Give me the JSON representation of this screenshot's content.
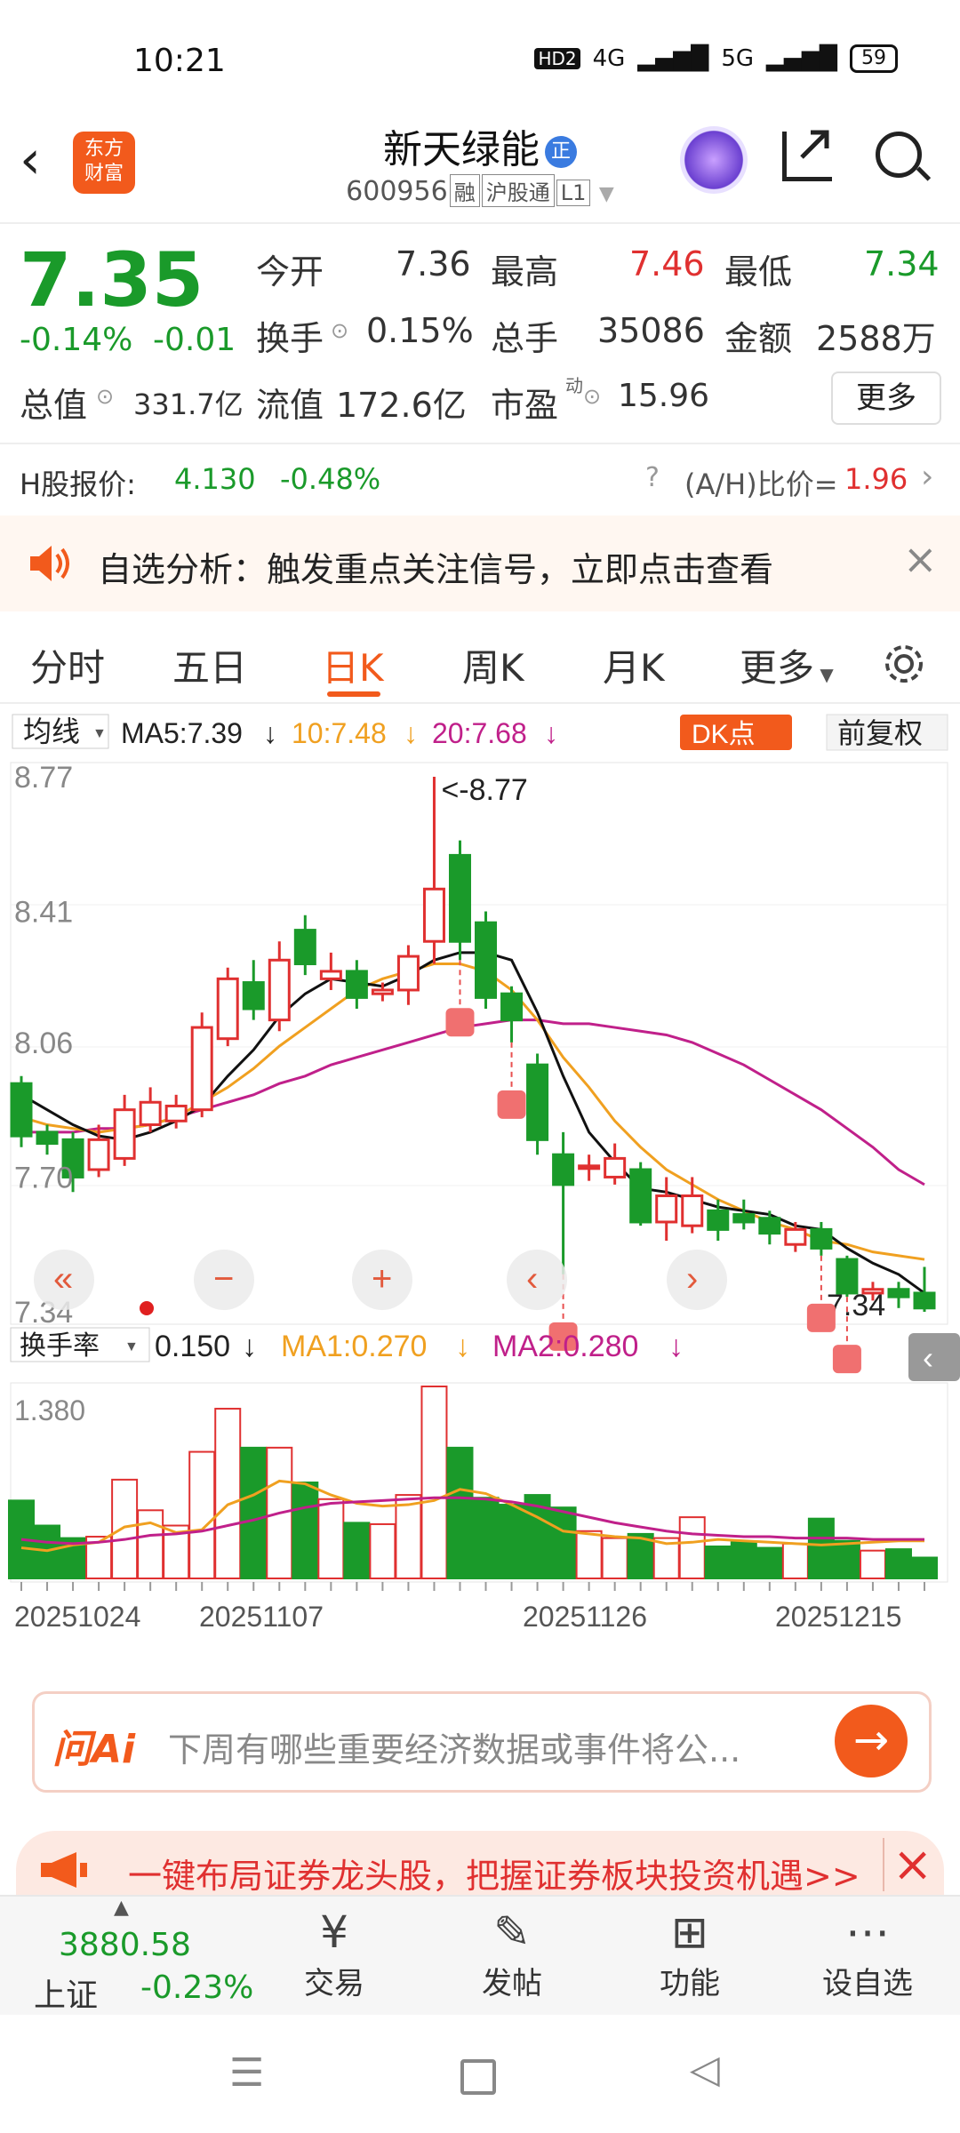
{
  "status": {
    "time": "10:21",
    "hd": "HD2",
    "net1": "4G",
    "net2": "5G",
    "battery": "59"
  },
  "header": {
    "logo_line1": "东方",
    "logo_line2": "财富",
    "stock_name": "新天绿能",
    "stock_badge": "正",
    "stock_code": "600956",
    "tags": [
      "融",
      "沪股通",
      "L1"
    ]
  },
  "quote": {
    "price": "7.35",
    "change_pct": "-0.14%",
    "change": "-0.01",
    "open_label": "今开",
    "open": "7.36",
    "high_label": "最高",
    "high": "7.46",
    "low_label": "最低",
    "low": "7.34",
    "turnover_label": "换手",
    "turnover": "0.15%",
    "volume_label": "总手",
    "volume": "35086",
    "amount_label": "金额",
    "amount": "2588万",
    "mcap_label": "总值",
    "mcap": "331.7亿",
    "float_label": "流值",
    "float": "172.6亿",
    "pe_label": "市盈",
    "pe_sup": "动",
    "pe": "15.96",
    "more": "更多"
  },
  "hshare": {
    "label": "H股报价:",
    "price": "4.130",
    "pct": "-0.48%",
    "ah_label": "(A/H)比价=",
    "ah_value": "1.96"
  },
  "notice": {
    "text": "自选分析：触发重点关注信号，立即点击查看"
  },
  "tabs": [
    "分时",
    "五日",
    "日K",
    "周K",
    "月K",
    "更多"
  ],
  "active_tab": "日K",
  "ma_bar": {
    "select": "均线",
    "ma5": "MA5:7.39",
    "ma10": "10:7.48",
    "ma20": "20:7.68",
    "dk": "DK点",
    "fq": "前复权"
  },
  "vol_bar": {
    "select": "换手率",
    "value": "0.150",
    "ma1": "MA1:0.270",
    "ma2": "MA2:0.280"
  },
  "colors": {
    "up": "#e03030",
    "down": "#1a9a2a",
    "ma5": "#111111",
    "ma10": "#f0a020",
    "ma20": "#c0208a",
    "accent": "#f25a1c"
  },
  "chart_data": {
    "type": "candlestick",
    "y_ticks": [
      "8.77",
      "8.41",
      "8.06",
      "7.70",
      "7.34"
    ],
    "ylim": [
      7.34,
      8.77
    ],
    "max_label": "<-8.77",
    "last_label": "7.34",
    "x_ticks": [
      "20251024",
      "20251107",
      "20251126",
      "20251215"
    ],
    "candles": [
      [
        7.95,
        7.81,
        7.97,
        7.78
      ],
      [
        7.82,
        7.79,
        7.84,
        7.76
      ],
      [
        7.8,
        7.7,
        7.82,
        7.66
      ],
      [
        7.72,
        7.8,
        7.84,
        7.7
      ],
      [
        7.75,
        7.88,
        7.92,
        7.73
      ],
      [
        7.84,
        7.9,
        7.94,
        7.82
      ],
      [
        7.85,
        7.89,
        7.92,
        7.83
      ],
      [
        7.88,
        8.1,
        8.14,
        7.86
      ],
      [
        8.07,
        8.23,
        8.26,
        8.05
      ],
      [
        8.22,
        8.15,
        8.28,
        8.12
      ],
      [
        8.12,
        8.28,
        8.33,
        8.09
      ],
      [
        8.36,
        8.27,
        8.4,
        8.24
      ],
      [
        8.23,
        8.25,
        8.3,
        8.2
      ],
      [
        8.25,
        8.18,
        8.28,
        8.15
      ],
      [
        8.19,
        8.2,
        8.22,
        8.17
      ],
      [
        8.2,
        8.29,
        8.32,
        8.16
      ],
      [
        8.33,
        8.47,
        8.77,
        8.27
      ],
      [
        8.56,
        8.33,
        8.6,
        8.28
      ],
      [
        8.38,
        8.18,
        8.41,
        8.15
      ],
      [
        8.19,
        8.12,
        8.21,
        8.06
      ],
      [
        8.0,
        7.8,
        8.03,
        7.76
      ],
      [
        7.76,
        7.68,
        7.82,
        7.44
      ],
      [
        7.73,
        7.73,
        7.76,
        7.69
      ],
      [
        7.7,
        7.75,
        7.79,
        7.68
      ],
      [
        7.72,
        7.58,
        7.74,
        7.57
      ],
      [
        7.58,
        7.65,
        7.7,
        7.53
      ],
      [
        7.57,
        7.65,
        7.7,
        7.55
      ],
      [
        7.61,
        7.56,
        7.64,
        7.53
      ],
      [
        7.6,
        7.58,
        7.64,
        7.56
      ],
      [
        7.59,
        7.55,
        7.61,
        7.52
      ],
      [
        7.52,
        7.56,
        7.58,
        7.5
      ],
      [
        7.56,
        7.51,
        7.58,
        7.49
      ],
      [
        7.48,
        7.39,
        7.49,
        7.38
      ],
      [
        7.39,
        7.4,
        7.42,
        7.37
      ],
      [
        7.4,
        7.38,
        7.42,
        7.35
      ],
      [
        7.39,
        7.35,
        7.46,
        7.34
      ]
    ],
    "ma5": [
      7.92,
      7.88,
      7.84,
      7.81,
      7.8,
      7.82,
      7.85,
      7.89,
      7.97,
      8.04,
      8.13,
      8.19,
      8.23,
      8.22,
      8.21,
      8.24,
      8.28,
      8.3,
      8.3,
      8.28,
      8.14,
      7.97,
      7.82,
      7.74,
      7.67,
      7.66,
      7.64,
      7.62,
      7.61,
      7.6,
      7.57,
      7.56,
      7.51,
      7.47,
      7.44,
      7.39
    ],
    "ma10": [
      7.86,
      7.84,
      7.83,
      7.82,
      7.83,
      7.84,
      7.86,
      7.9,
      7.94,
      7.99,
      8.05,
      8.1,
      8.15,
      8.2,
      8.23,
      8.25,
      8.27,
      8.27,
      8.25,
      8.2,
      8.12,
      8.02,
      7.94,
      7.85,
      7.78,
      7.72,
      7.68,
      7.64,
      7.61,
      7.58,
      7.56,
      7.53,
      7.52,
      7.5,
      7.49,
      7.48
    ],
    "ma20": [
      7.82,
      7.82,
      7.82,
      7.83,
      7.83,
      7.84,
      7.86,
      7.88,
      7.9,
      7.92,
      7.95,
      7.97,
      8.0,
      8.02,
      8.04,
      8.06,
      8.08,
      8.1,
      8.11,
      8.12,
      8.12,
      8.11,
      8.11,
      8.1,
      8.09,
      8.08,
      8.06,
      8.03,
      8.0,
      7.96,
      7.92,
      7.88,
      7.83,
      7.78,
      7.72,
      7.68
    ],
    "b_markers": [
      17,
      19,
      21,
      31,
      32
    ],
    "volume": {
      "label_max": "1.380",
      "values": [
        0.56,
        0.38,
        0.29,
        0.3,
        0.71,
        0.49,
        0.38,
        0.91,
        1.22,
        0.94,
        0.94,
        0.69,
        0.57,
        0.4,
        0.39,
        0.6,
        1.38,
        0.94,
        0.58,
        0.53,
        0.6,
        0.51,
        0.34,
        0.29,
        0.32,
        0.29,
        0.44,
        0.23,
        0.26,
        0.22,
        0.25,
        0.43,
        0.27,
        0.2,
        0.21,
        0.15
      ],
      "ma1": [
        0.22,
        0.2,
        0.24,
        0.26,
        0.37,
        0.4,
        0.33,
        0.35,
        0.53,
        0.6,
        0.7,
        0.68,
        0.6,
        0.54,
        0.52,
        0.53,
        0.56,
        0.64,
        0.61,
        0.53,
        0.44,
        0.34,
        0.32,
        0.3,
        0.29,
        0.25,
        0.26,
        0.28,
        0.27,
        0.26,
        0.25,
        0.24,
        0.25,
        0.26,
        0.27,
        0.27
      ],
      "ma2": [
        0.28,
        0.26,
        0.25,
        0.26,
        0.28,
        0.31,
        0.32,
        0.34,
        0.38,
        0.42,
        0.47,
        0.51,
        0.54,
        0.55,
        0.56,
        0.57,
        0.58,
        0.58,
        0.57,
        0.55,
        0.52,
        0.48,
        0.44,
        0.4,
        0.37,
        0.34,
        0.32,
        0.31,
        0.3,
        0.3,
        0.29,
        0.29,
        0.29,
        0.28,
        0.28,
        0.28
      ]
    }
  },
  "ai": {
    "logo": "问Ai",
    "placeholder": "下周有哪些重要经济数据或事件将公..."
  },
  "promo": {
    "text": "一键布局证券龙头股，把握证券板块投资机遇>>"
  },
  "bottom_nav": {
    "index_value": "3880.58",
    "index_name": "上证",
    "index_pct": "-0.23%",
    "items": [
      {
        "label": "交易",
        "icon": "yen-circle-icon"
      },
      {
        "label": "发帖",
        "icon": "pencil-icon"
      },
      {
        "label": "功能",
        "icon": "grid-icon"
      },
      {
        "label": "设自选",
        "icon": "dots-circle-icon"
      }
    ]
  }
}
